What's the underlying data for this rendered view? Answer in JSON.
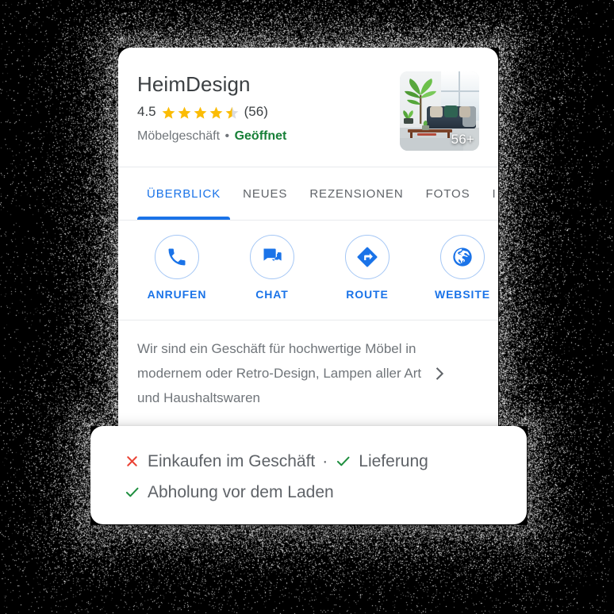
{
  "business": {
    "name": "HeimDesign",
    "rating_value": "4.5",
    "rating_numeric": 4.5,
    "review_count": "(56)",
    "category": "Möbelgeschäft",
    "separator": "•",
    "open_status": "Geöffnet",
    "photo_count_badge": "56+"
  },
  "colors": {
    "accent_blue": "#1a73e8",
    "action_ring": "#a5c7f5",
    "open_green": "#188038",
    "check_green": "#1e8e3e",
    "cross_red": "#ea4335",
    "star_gold": "#fbbc04",
    "star_empty": "#dadce0",
    "text_primary": "#3c4043",
    "text_secondary": "#70757a",
    "divider": "#e8eaed",
    "card_bg": "#ffffff",
    "page_bg": "#000000"
  },
  "tabs": [
    {
      "label": "ÜBERBLICK",
      "active": true
    },
    {
      "label": "NEUES",
      "active": false
    },
    {
      "label": "REZENSIONEN",
      "active": false
    },
    {
      "label": "FOTOS",
      "active": false
    },
    {
      "label": "I",
      "active": false
    }
  ],
  "actions": [
    {
      "label": "ANRUFEN",
      "icon": "phone-icon"
    },
    {
      "label": "CHAT",
      "icon": "chat-icon"
    },
    {
      "label": "ROUTE",
      "icon": "directions-icon"
    },
    {
      "label": "WEBSITE",
      "icon": "globe-icon"
    }
  ],
  "description": {
    "text": "Wir sind ein Geschäft für hochwertige Möbel in modernem oder Retro-Design, Lampen aller Art und Haushaltswaren",
    "chevron_icon": "chevron-right-icon"
  },
  "services": {
    "line1": [
      {
        "icon": "cross-icon",
        "available": false,
        "label": "Einkaufen im Geschäft"
      },
      {
        "icon": "check-icon",
        "available": true,
        "label": "Lieferung"
      }
    ],
    "line2": [
      {
        "icon": "check-icon",
        "available": true,
        "label": "Abholung vor dem Laden"
      }
    ],
    "divider_dot": "·"
  }
}
